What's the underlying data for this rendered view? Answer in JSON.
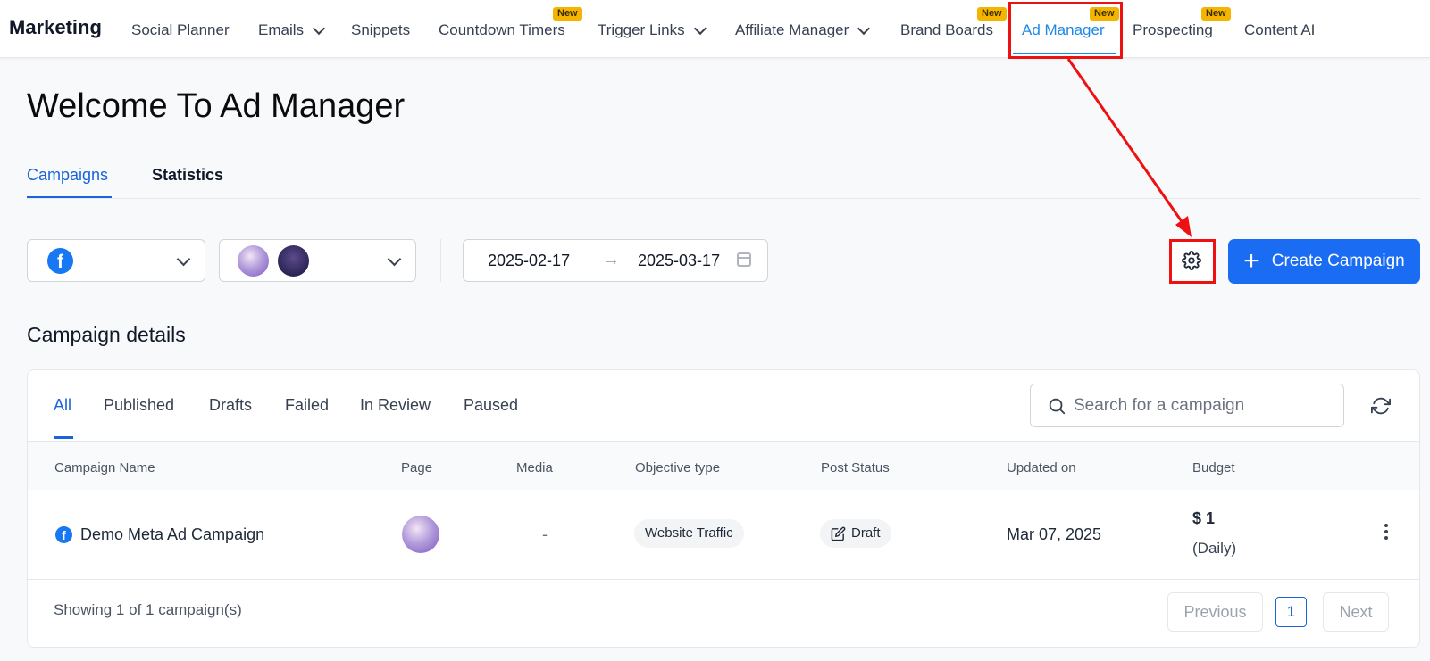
{
  "nav": {
    "brand": "Marketing",
    "items": [
      {
        "label": "Social Planner"
      },
      {
        "label": "Emails"
      },
      {
        "label": "Snippets"
      },
      {
        "label": "Countdown Timers",
        "badge": "New"
      },
      {
        "label": "Trigger Links"
      },
      {
        "label": "Affiliate Manager"
      },
      {
        "label": "Brand Boards",
        "badge": "New"
      },
      {
        "label": "Ad Manager",
        "badge": "New",
        "active": true
      },
      {
        "label": "Prospecting",
        "badge": "New"
      },
      {
        "label": "Content AI"
      }
    ]
  },
  "page": {
    "title": "Welcome To Ad Manager",
    "tabs": [
      {
        "label": "Campaigns",
        "active": true
      },
      {
        "label": "Statistics"
      }
    ]
  },
  "filters": {
    "date_start": "2025-02-17",
    "date_arrow": "→",
    "date_end": "2025-03-17",
    "create_button": "Create Campaign"
  },
  "details": {
    "title": "Campaign details",
    "status_tabs": [
      "All",
      "Published",
      "Drafts",
      "Failed",
      "In Review",
      "Paused"
    ],
    "search_placeholder": "Search for a campaign",
    "columns": [
      "Campaign Name",
      "Page",
      "Media",
      "Objective type",
      "Post Status",
      "Updated on",
      "Budget"
    ],
    "rows": [
      {
        "name": "Demo Meta Ad Campaign",
        "media": "-",
        "objective": "Website Traffic",
        "status": "Draft",
        "updated": "Mar 07, 2025",
        "budget": "$ 1",
        "budget_period": "(Daily)"
      }
    ],
    "footer": "Showing 1 of 1 campaign(s)",
    "prev": "Previous",
    "page_number": "1",
    "next": "Next"
  },
  "colors": {
    "accent": "#1a6cf3",
    "active_nav": "#1e88e5",
    "highlight": "#ee1111",
    "badge": "#f5b400"
  },
  "icons": {
    "platform": "facebook-icon",
    "settings": "gear-icon",
    "refresh": "refresh-icon",
    "search": "search-icon"
  }
}
